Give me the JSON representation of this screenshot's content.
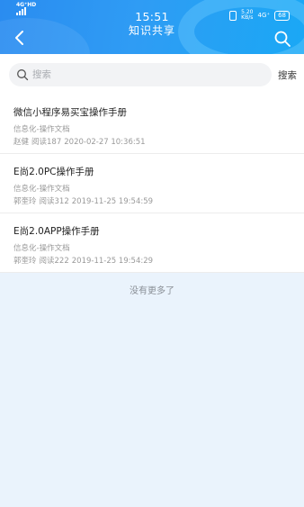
{
  "status_bar": {
    "network": "4G⁺HD",
    "time": "15:51",
    "speed_value": "5.20",
    "speed_unit": "KB/s",
    "net_type": "4G⁺",
    "battery": "68"
  },
  "header": {
    "title": "知识共享"
  },
  "search": {
    "placeholder": "搜索",
    "submit_label": "搜索"
  },
  "documents": [
    {
      "title": "微信小程序易买宝操作手册",
      "category": "信息化-操作文档",
      "author": "赵健",
      "reads": "阅读187",
      "datetime": "2020-02-27 10:36:51"
    },
    {
      "title": "E尚2.0PC操作手册",
      "category": "信息化-操作文档",
      "author": "郭奎玲",
      "reads": "阅读312",
      "datetime": "2019-11-25 19:54:59"
    },
    {
      "title": "E尚2.0APP操作手册",
      "category": "信息化-操作文档",
      "author": "郭奎玲",
      "reads": "阅读222",
      "datetime": "2019-11-25 19:54:29"
    }
  ],
  "footer": {
    "no_more": "没有更多了"
  },
  "icons": {
    "back": "chevron-left-icon",
    "search": "search-icon",
    "vibrate": "vibrate-icon",
    "signal": "signal-icon"
  },
  "colors": {
    "header_blue": "#2f9cf4",
    "page_bg": "#eaf3fc",
    "muted_text": "#9a9a9a"
  }
}
